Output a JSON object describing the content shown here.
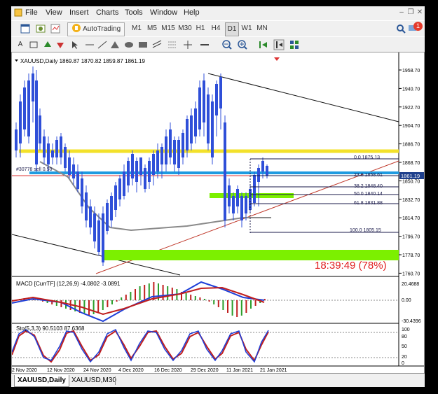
{
  "menu": [
    "File",
    "View",
    "Insert",
    "Charts",
    "Tools",
    "Window",
    "Help"
  ],
  "toolbar": {
    "autotrading_label": "AutoTrading",
    "timeframes": [
      "M1",
      "M5",
      "M15",
      "M30",
      "H1",
      "H4",
      "D1",
      "W1",
      "MN"
    ],
    "active_timeframe": "D1",
    "notification_count": "1"
  },
  "chart": {
    "header": "XAUUSD,Daily  1869.87 1870.82 1859.87 1861.19",
    "price_axis": [
      "1958.70",
      "1940.70",
      "1922.70",
      "1904.70",
      "1886.70",
      "1868.70",
      "1850.70",
      "1832.70",
      "1814.70",
      "1796.70",
      "1778.70",
      "1760.70"
    ],
    "current_price": "1861.19",
    "date_axis": [
      "2 Nov 2020",
      "12 Nov 2020",
      "24 Nov 2020",
      "4 Dec 2020",
      "16 Dec 2020",
      "29 Dec 2020",
      "11 Jan 2021",
      "21 Jan 2021"
    ],
    "order_label": "#30778  sell 0.50",
    "fib_levels": [
      "0.0  1875.13",
      "23.6  1858.61",
      "38.2  1848.40",
      "50.0  1840.14",
      "61.8  1831.88",
      "100.0  1805.15"
    ],
    "countdown": "18:39:49 (78%)",
    "colors": {
      "bull": "#2f4fd8",
      "bear": "#2f4fd8",
      "yellow_line": "#f3e12a",
      "blue_line": "#1f9be0",
      "green_zone": "#7cf000",
      "countdown": "#e01e1e"
    }
  },
  "macd": {
    "label": "MACD [CurrTF] (12,26,9) -4.0802 -3.0891",
    "axis": [
      "20.4688",
      "0.00",
      "-30.4396"
    ]
  },
  "stoch": {
    "label": "Sto(5,3,3) 90.5103 87.6368",
    "axis": [
      "100",
      "80",
      "50",
      "20",
      "0"
    ]
  },
  "tabs": [
    "XAUUSD,Daily",
    "XAUUSD,M30"
  ],
  "active_tab": "XAUUSD,Daily"
}
